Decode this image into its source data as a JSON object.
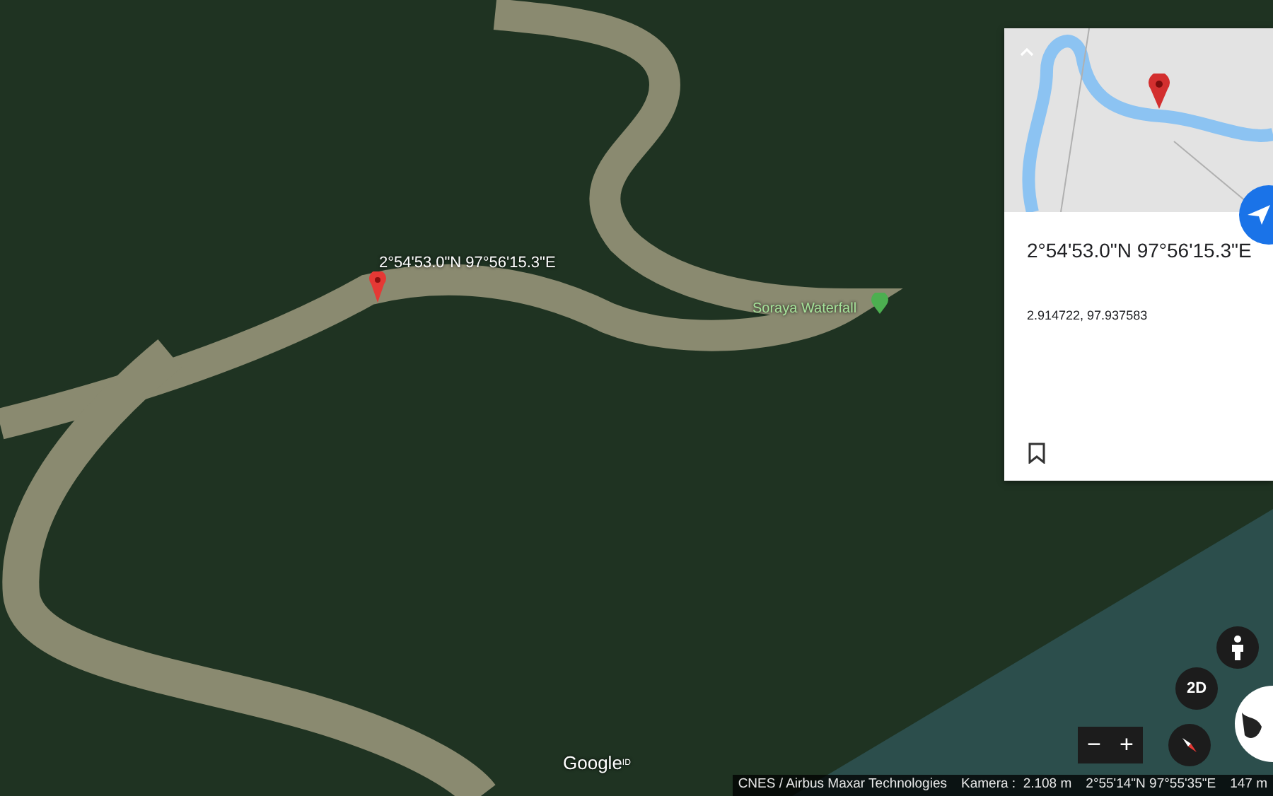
{
  "map": {
    "pin_label": "2°54'53.0\"N 97°56'15.3\"E",
    "place_label": "Soraya Waterfall",
    "logo": "Google$^{ID}$"
  },
  "info_card": {
    "coordinates": "2°54'53.0\"N 97°56'15.3\"E",
    "decimal": "2.914722, 97.937583"
  },
  "controls": {
    "view_mode": "2D",
    "zoom_out": "−",
    "zoom_in": "+"
  },
  "status_bar": {
    "attribution": "CNES / Airbus Maxar Technologies",
    "camera": "Kamera :  2.108 m",
    "position": "2°55'14\"N 97°55'35\"E",
    "scale": "147 m"
  }
}
